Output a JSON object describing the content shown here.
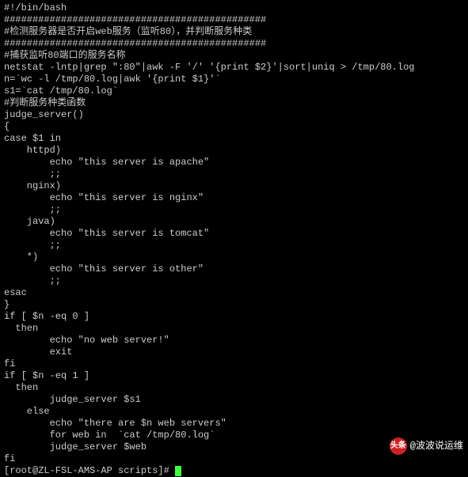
{
  "lines": [
    "#!/bin/bash",
    "##############################################",
    "#检测服务器是否开启web服务（监听80），并判断服务种类",
    "##############################################",
    "#捕获监听80端口的服务名称",
    "netstat -lntp|grep \":80\"|awk -F '/' '{print $2}'|sort|uniq > /tmp/80.log",
    "n=`wc -l /tmp/80.log|awk '{print $1}'`",
    "s1=`cat /tmp/80.log`",
    "#判断服务种类函数",
    "judge_server()",
    "{",
    "case $1 in",
    "    httpd)",
    "        echo \"this server is apache\"",
    "        ;;",
    "    nginx)",
    "        echo \"this server is nginx\"",
    "        ;;",
    "    java)",
    "        echo \"this server is tomcat\"",
    "        ;;",
    "    *)",
    "        echo \"this server is other\"",
    "        ;;",
    "esac",
    "}",
    "if [ $n -eq 0 ]",
    "  then",
    "        echo \"no web server!\"",
    "        exit",
    "fi",
    "if [ $n -eq 1 ]",
    "  then",
    "        judge_server $s1",
    "    else",
    "        echo \"there are $n web servers\"",
    "        for web in  `cat /tmp/80.log`",
    "        judge_server $web",
    "fi"
  ],
  "prompt": "[root@ZL-FSL-AMS-AP scripts]# ",
  "watermark": {
    "label": "头条",
    "handle": "@波波说运维"
  }
}
